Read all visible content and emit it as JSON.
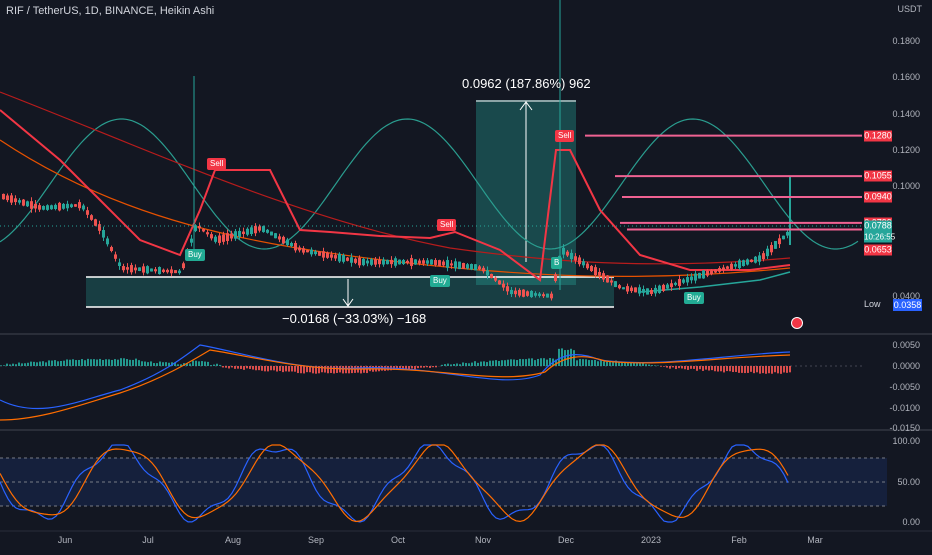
{
  "header": {
    "symbol": "RIF / TetherUS, 1D, BINANCE, Heikin Ashi",
    "currency": "USDT"
  },
  "price_axis": {
    "ticks": [
      {
        "label": "0.1800",
        "v": 0.18
      },
      {
        "label": "0.1600",
        "v": 0.16
      },
      {
        "label": "0.1400",
        "v": 0.14
      },
      {
        "label": "0.1200",
        "v": 0.12
      },
      {
        "label": "0.1000",
        "v": 0.1
      },
      {
        "label": "0.0400",
        "v": 0.04
      }
    ],
    "labels": [
      {
        "label": "0.1280",
        "v": 0.128,
        "color": "#f23645"
      },
      {
        "label": "0.1055",
        "v": 0.1055,
        "color": "#f23645"
      },
      {
        "label": "0.0940",
        "v": 0.094,
        "color": "#f23645"
      },
      {
        "label": "0.0799",
        "v": 0.0799,
        "color": "#f23645"
      },
      {
        "label": "0.0763",
        "v": 0.0763,
        "color": "#f23645"
      },
      {
        "label": "0.0653",
        "v": 0.0653,
        "color": "#f23645"
      }
    ],
    "last_price": "0.0788",
    "countdown": "10:26:55",
    "low_label": "Low",
    "low_value": "0.0358"
  },
  "macd_axis": [
    "0.0050",
    "0.0000",
    "-0.0050",
    "-0.0100",
    "-0.0150"
  ],
  "stoch_axis": [
    "100.00",
    "50.00",
    "0.00"
  ],
  "time_axis": [
    "Jun",
    "Jul",
    "Aug",
    "Sep",
    "Oct",
    "Nov",
    "Dec",
    "2023",
    "Feb",
    "Mar"
  ],
  "measures": {
    "up": "0.0962 (187.86%) 962",
    "down": "−0.0168 (−33.03%) −168"
  },
  "signals": {
    "sell": "Sell",
    "buy": "Buy",
    "buy_cut": "B"
  },
  "colors": {
    "bg": "#131722",
    "up": "#26a69a",
    "down": "#ef5350",
    "sar": "#f23645",
    "sine": "#2a9d8f",
    "white": "#ffffff",
    "macd": "#2962ff",
    "signal": "#ff6d00"
  }
}
